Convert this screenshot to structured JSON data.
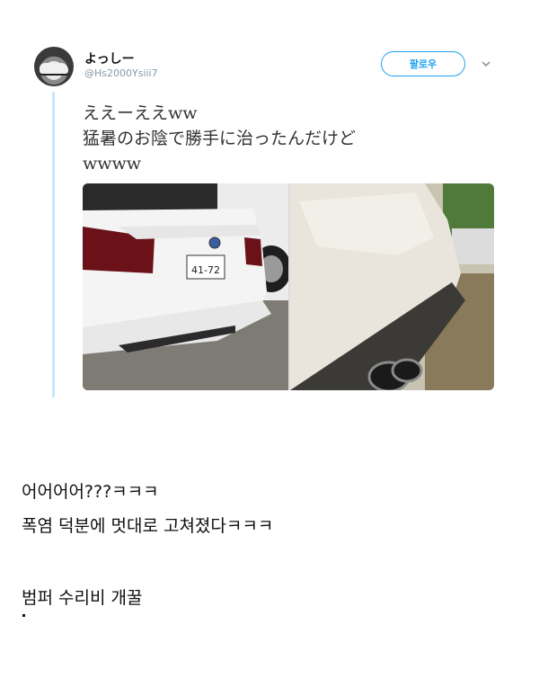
{
  "tweet": {
    "display_name": "よっしー",
    "handle": "@Hs2000Ysiii7",
    "follow_label": "팔로우",
    "text_lines": [
      "ええーええww",
      "猛暑のお陰で勝手に治ったんだけど",
      "wwww"
    ],
    "photos": [
      {
        "icon": "car-rear-photo",
        "plate": "4172"
      },
      {
        "icon": "bumper-closeup-photo"
      }
    ]
  },
  "post": {
    "lines": [
      "어어어어???ㅋㅋㅋ",
      "폭염 덕분에 멋대로 고쳐졌다ㅋㅋㅋ",
      "범퍼 수리비 개꿀"
    ]
  }
}
